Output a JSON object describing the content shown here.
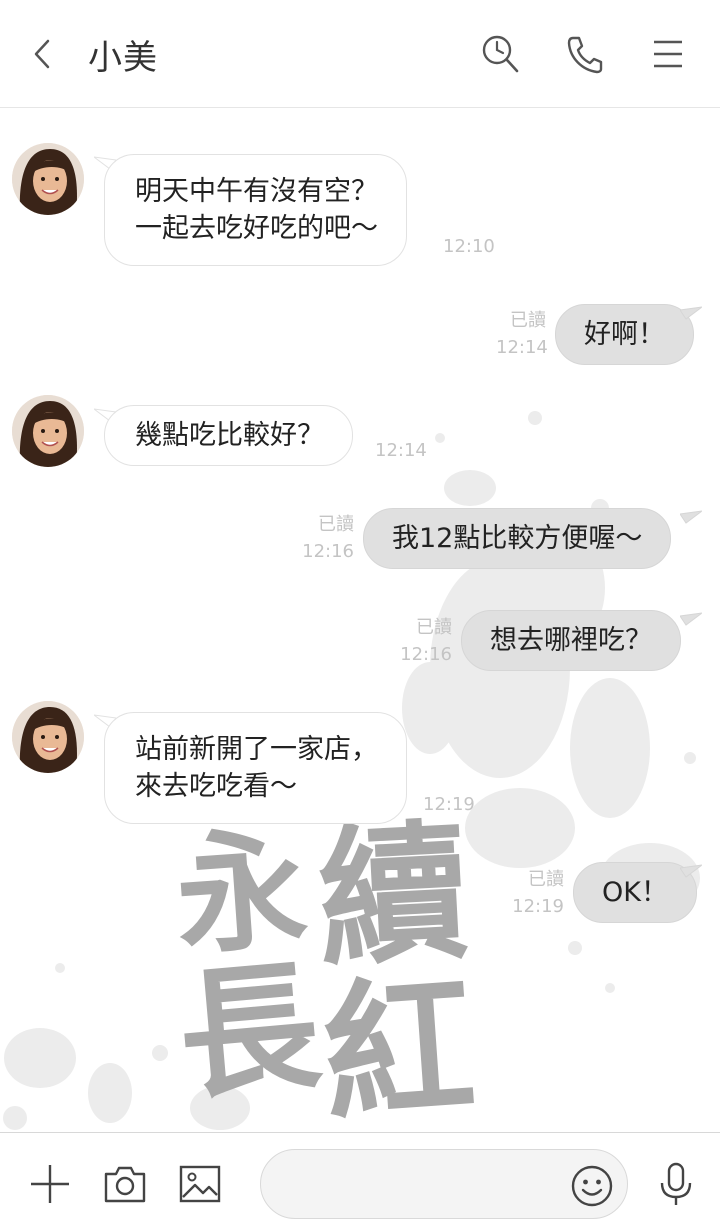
{
  "header": {
    "title": "小美",
    "icons": [
      "back-arrow-icon",
      "search-clock-icon",
      "phone-icon",
      "menu-icon"
    ]
  },
  "messages": [
    {
      "side": "in",
      "lines": [
        "明天中午有沒有空？",
        "一起去吃好吃的吧～"
      ],
      "time": "12:10"
    },
    {
      "side": "out",
      "lines": [
        "好啊！"
      ],
      "read": "已讀",
      "time": "12:14"
    },
    {
      "side": "in",
      "lines": [
        "幾點吃比較好？"
      ],
      "time": "12:14"
    },
    {
      "side": "out",
      "lines": [
        "我12點比較方便喔～"
      ],
      "read": "已讀",
      "time": "12:16"
    },
    {
      "side": "out",
      "lines": [
        "想去哪裡吃？"
      ],
      "read": "已讀",
      "time": "12:16"
    },
    {
      "side": "in",
      "lines": [
        "站前新開了一家店，",
        "來去吃吃看～"
      ],
      "time": "12:19"
    },
    {
      "side": "out",
      "lines": [
        "OK！"
      ],
      "read": "已讀",
      "time": "12:19"
    }
  ],
  "background": {
    "calligraphy": [
      "永",
      "續",
      "長",
      "紅"
    ],
    "color": "#a8a8a8"
  },
  "footer": {
    "icons": [
      "plus-icon",
      "camera-icon",
      "image-icon",
      "emoji-icon",
      "mic-icon"
    ],
    "input_value": "",
    "input_placeholder": ""
  },
  "colors": {
    "out_bubble": "#e0e0e0",
    "in_bubble": "#ffffff",
    "meta_text": "#c4c4c4"
  }
}
